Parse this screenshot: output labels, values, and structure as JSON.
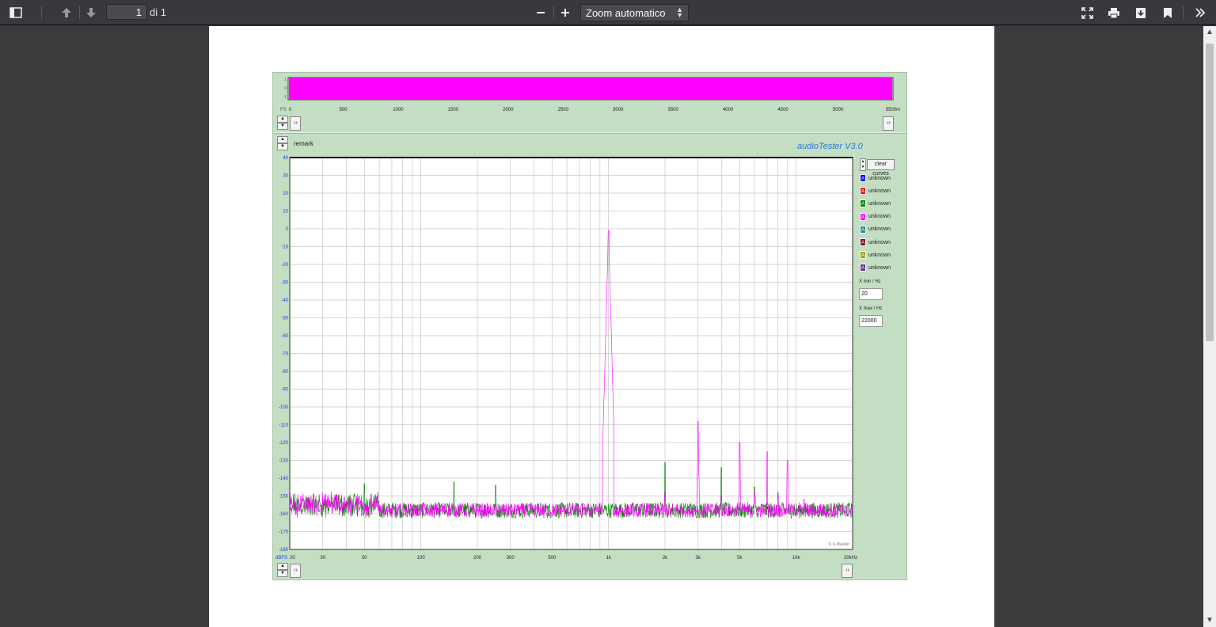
{
  "toolbar": {
    "page_number": "1",
    "page_count": "di 1",
    "zoom_label": "Zoom automatico",
    "icons": [
      "sidebar-toggle-icon",
      "arrow-up-icon",
      "arrow-down-icon",
      "minus-icon",
      "plus-icon",
      "fullscreen-icon",
      "print-icon",
      "download-icon",
      "bookmark-icon",
      "tools-icon"
    ]
  },
  "audiotester": {
    "remark": "remark",
    "brand": "audioTester  V3.0",
    "clear_curves": "clear curves",
    "legend": [
      {
        "label": "unknown",
        "color": "#0000e0"
      },
      {
        "label": "unknown",
        "color": "#e02020"
      },
      {
        "label": "unknown",
        "color": "#008000"
      },
      {
        "label": "unknown",
        "color": "#ff00ff"
      },
      {
        "label": "unknown",
        "color": "#208a8a"
      },
      {
        "label": "unknown",
        "color": "#800020"
      },
      {
        "label": "unknown",
        "color": "#a0a000"
      },
      {
        "label": "unknown",
        "color": "#6a2a8a"
      }
    ],
    "legend_glyph": "A",
    "xmin_label": "X min / Hz",
    "xmin_value": "20",
    "xmax_label": "X max / Hz",
    "xmax_value": "22000",
    "copyright": "© U.Mueller"
  },
  "chart_data": [
    {
      "type": "area",
      "subject": "time-domain waveform (top strip)",
      "x_ticks": [
        "0",
        "500",
        "1000",
        "1500",
        "2000",
        "2500",
        "3000",
        "3500",
        "4000",
        "4500",
        "5000",
        "5500m"
      ],
      "y_ticks": [
        "1",
        "0",
        "-1"
      ],
      "unit_label": "FS",
      "series": [
        {
          "color": "#ff00ff",
          "values_note": "",
          "min": -1,
          "max": 1
        }
      ],
      "xlim": [
        0,
        5500
      ],
      "ylim": [
        -1,
        1
      ]
    },
    {
      "type": "line",
      "subject": "FFT spectrum",
      "x_scale": "log",
      "xlim": [
        20,
        20000
      ],
      "ylim": [
        -180,
        40
      ],
      "x_ticks": [
        "20",
        "30",
        "50",
        "100",
        "200",
        "300",
        "500",
        "1k",
        "2k",
        "3k",
        "5k",
        "10k",
        "20kHz"
      ],
      "x_tick_values": [
        20,
        30,
        50,
        100,
        200,
        300,
        500,
        1000,
        2000,
        3000,
        5000,
        10000,
        20000
      ],
      "y_ticks": [
        "40",
        "30",
        "20",
        "10",
        "0",
        "-10",
        "-20",
        "-30",
        "-40",
        "-50",
        "-60",
        "-70",
        "-80",
        "-90",
        "-100",
        "-110",
        "-120",
        "-130",
        "-140",
        "-150",
        "-160",
        "-170",
        "-180"
      ],
      "y_unit": "dBFS",
      "grid": true,
      "noise_floor_db": -158,
      "series": [
        {
          "color": "#ff00ff",
          "peaks": [
            {
              "x": 1000,
              "y": -1
            },
            {
              "x": 3000,
              "y": -108
            },
            {
              "x": 5000,
              "y": -120
            },
            {
              "x": 7000,
              "y": -125
            },
            {
              "x": 9000,
              "y": -130
            },
            {
              "x": 2000,
              "y": -148
            },
            {
              "x": 4000,
              "y": -150
            },
            {
              "x": 6000,
              "y": -148
            },
            {
              "x": 8000,
              "y": -150
            },
            {
              "x": 11000,
              "y": -152
            }
          ]
        },
        {
          "color": "#008000",
          "peaks": [
            {
              "x": 2000,
              "y": -131
            },
            {
              "x": 4000,
              "y": -134
            },
            {
              "x": 50,
              "y": -143
            },
            {
              "x": 150,
              "y": -142
            },
            {
              "x": 250,
              "y": -144
            },
            {
              "x": 6000,
              "y": -145
            },
            {
              "x": 8000,
              "y": -148
            }
          ]
        }
      ]
    }
  ]
}
